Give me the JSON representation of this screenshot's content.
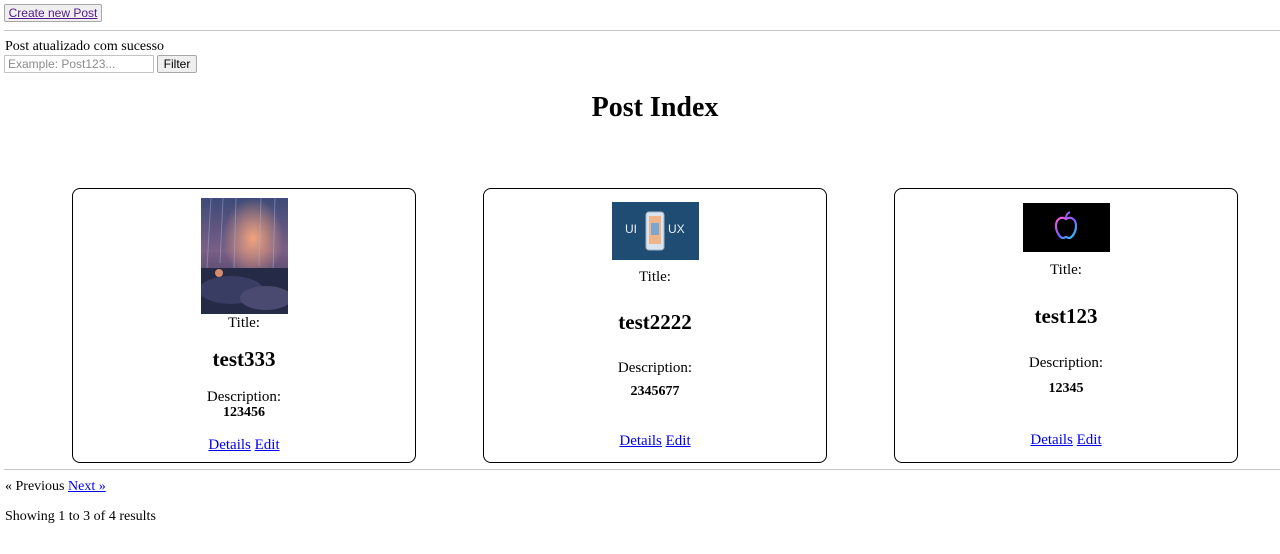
{
  "header": {
    "create_label": "Create new Post"
  },
  "flash": {
    "message": "Post atualizado com sucesso"
  },
  "filter": {
    "placeholder": "Example: Post123...",
    "value": "",
    "button_label": "Filter"
  },
  "page": {
    "title": "Post Index"
  },
  "posts": [
    {
      "image_icon": "rainy-room-thumbnail-icon",
      "title_label": "Title:",
      "title": "test333",
      "description_label": "Description:",
      "description": "123456",
      "details_label": "Details",
      "edit_label": "Edit"
    },
    {
      "image_icon": "ui-ux-thumbnail-icon",
      "image_text_left": "UI",
      "image_text_right": "UX",
      "title_label": "Title:",
      "title": "test2222",
      "description_label": "Description:",
      "description": "2345677",
      "details_label": "Details",
      "edit_label": "Edit"
    },
    {
      "image_icon": "apple-logo-thumbnail-icon",
      "title_label": "Title:",
      "title": "test123",
      "description_label": "Description:",
      "description": "12345",
      "details_label": "Details",
      "edit_label": "Edit"
    }
  ],
  "pagination": {
    "previous_label": "« Previous",
    "next_label": "Next »"
  },
  "summary": {
    "text": "Showing 1 to 3 of 4 results"
  }
}
